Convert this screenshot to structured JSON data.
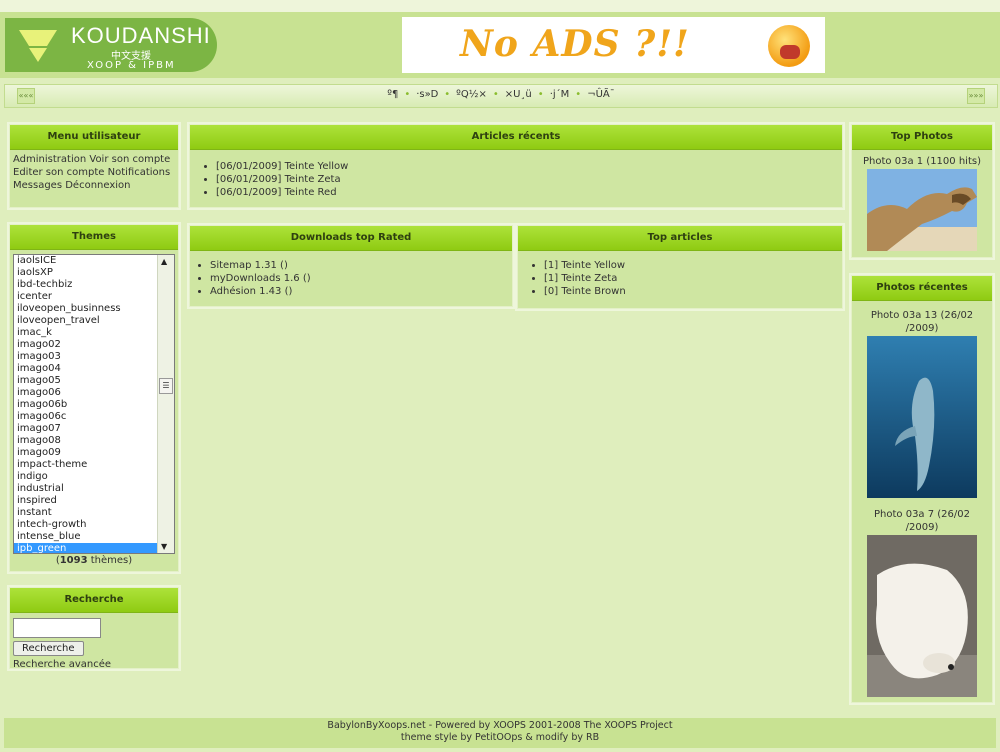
{
  "header": {
    "logo_title": "KOUDANSHI",
    "logo_cn": "中文支援",
    "logo_sub": "XOOP & IPBM",
    "banner_text": "No ADS ?!!"
  },
  "navbar": {
    "left_btn": "«««",
    "right_btn": "»»»",
    "links": [
      "º¶",
      "·s»D",
      "ºQ½×",
      "×U¸ü",
      "·j´M",
      "¬ÛÃ¯"
    ]
  },
  "user_menu": {
    "title": "Menu utilisateur",
    "items": [
      "Administration",
      "Voir son compte",
      "Editer son compte",
      "Notifications",
      "Messages",
      "Déconnexion"
    ]
  },
  "themes": {
    "title": "Themes",
    "options": [
      "iaolsICE",
      "iaolsXP",
      "ibd-techbiz",
      "icenter",
      "iloveopen_businness",
      "iloveopen_travel",
      "imac_k",
      "imago02",
      "imago03",
      "imago04",
      "imago05",
      "imago06",
      "imago06b",
      "imago06c",
      "imago07",
      "imago08",
      "imago09",
      "impact-theme",
      "indigo",
      "industrial",
      "inspired",
      "instant",
      "intech-growth",
      "intense_blue",
      "ipb_green"
    ],
    "selected_index": 24,
    "count": "1093",
    "count_suffix": " thèmes)",
    "count_prefix": "("
  },
  "search": {
    "title": "Recherche",
    "button": "Recherche",
    "advanced": "Recherche avancée"
  },
  "recent_articles": {
    "title": "Articles récents",
    "items": [
      "[06/01/2009] Teinte Yellow",
      "[06/01/2009] Teinte Zeta",
      "[06/01/2009] Teinte Red"
    ]
  },
  "downloads": {
    "title": "Downloads top Rated",
    "items": [
      "Sitemap 1.31 ()",
      "myDownloads 1.6 ()",
      "Adhésion 1.43 ()"
    ]
  },
  "top_articles": {
    "title": "Top articles",
    "items": [
      "[1] Teinte Yellow",
      "[1] Teinte Zeta",
      "[0] Teinte Brown"
    ]
  },
  "top_photos": {
    "title": "Top Photos",
    "caption": "Photo 03a 1 (1100 hits)"
  },
  "recent_photos": {
    "title": "Photos récentes",
    "caption1_line1": "Photo 03a 13 (26/02",
    "caption1_line2": "/2009)",
    "caption2_line1": "Photo 03a 7 (26/02",
    "caption2_line2": "/2009)"
  },
  "footer": {
    "line1": "BabylonByXoops.net - Powered by XOOPS 2001-2008 The XOOPS Project",
    "line2": "theme style by PetitOOps & modify by RB"
  },
  "colors": {
    "page_bg": "#dfeebd",
    "header_bg": "#c8e292",
    "title_bar": "#9cd326",
    "selection": "#3399ff"
  }
}
